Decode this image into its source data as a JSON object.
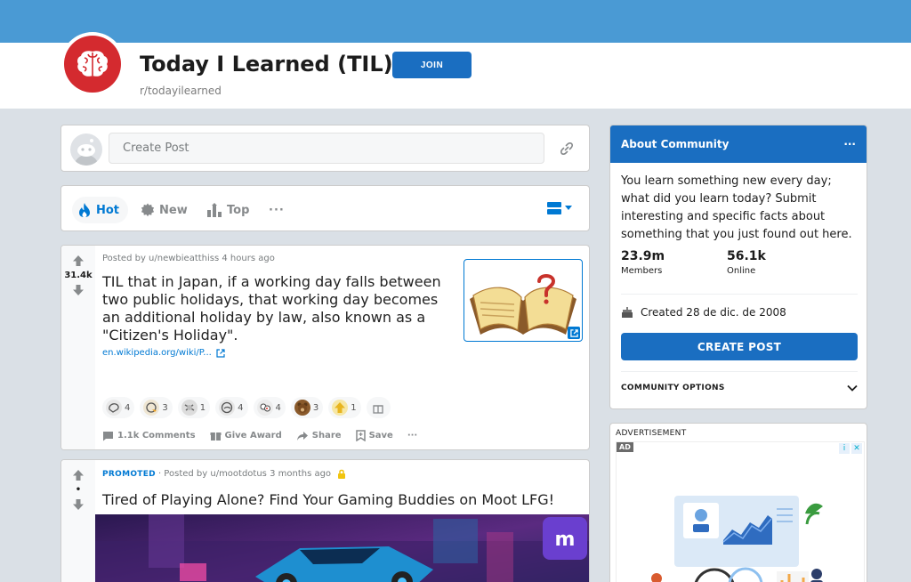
{
  "header": {
    "title": "Today I Learned (TIL)",
    "subreddit": "r/todayilearned",
    "join_label": "JOIN"
  },
  "create_post": {
    "placeholder": "Create Post"
  },
  "sort": {
    "hot": "Hot",
    "new": "New",
    "top": "Top",
    "more": "···"
  },
  "post1": {
    "score": "31.4k",
    "meta": "Posted by u/newbieatthiss 4 hours ago",
    "title": "TIL that in Japan, if a working day falls between two public holidays, that working day becomes an additional holiday by law, also known as a \"Citizen's Holiday\".",
    "link": "en.wikipedia.org/wiki/P...",
    "awards": [
      {
        "icon": "helpful-award-icon",
        "count": "4"
      },
      {
        "icon": "wholesome-award-icon",
        "count": "3"
      },
      {
        "icon": "silver-award-icon",
        "count": "1"
      },
      {
        "icon": "hugz-award-icon",
        "count": "4"
      },
      {
        "icon": "faces-award-icon",
        "count": "4"
      },
      {
        "icon": "bear-award-icon",
        "count": "3"
      },
      {
        "icon": "gold-award-icon",
        "count": "1"
      },
      {
        "icon": "gift-award-icon",
        "count": ""
      }
    ],
    "actions": {
      "comments": "1.1k Comments",
      "award": "Give Award",
      "share": "Share",
      "save": "Save",
      "more": "···"
    }
  },
  "post2": {
    "score": "•",
    "promoted": "PROMOTED",
    "meta": "· Posted by u/mootdotus 3 months ago",
    "title": "Tired of Playing Alone? Find Your Gaming Buddies on Moot LFG!"
  },
  "about": {
    "heading": "About Community",
    "more": "···",
    "description": "You learn something new every day; what did you learn today? Submit interesting and specific facts about something that you just found out here.",
    "members_count": "23.9m",
    "members_label": "Members",
    "online_count": "56.1k",
    "online_label": "Online",
    "created": "Created 28 de dic. de 2008",
    "create_post_label": "CREATE POST",
    "community_options": "COMMUNITY OPTIONS"
  },
  "ad": {
    "label": "ADVERTISEMENT",
    "tag": "AD"
  },
  "colors": {
    "banner": "#4a9ad4",
    "primary_blue": "#1a6ec1",
    "subreddit_red": "#d42a2f",
    "background": "#dae0e6"
  }
}
